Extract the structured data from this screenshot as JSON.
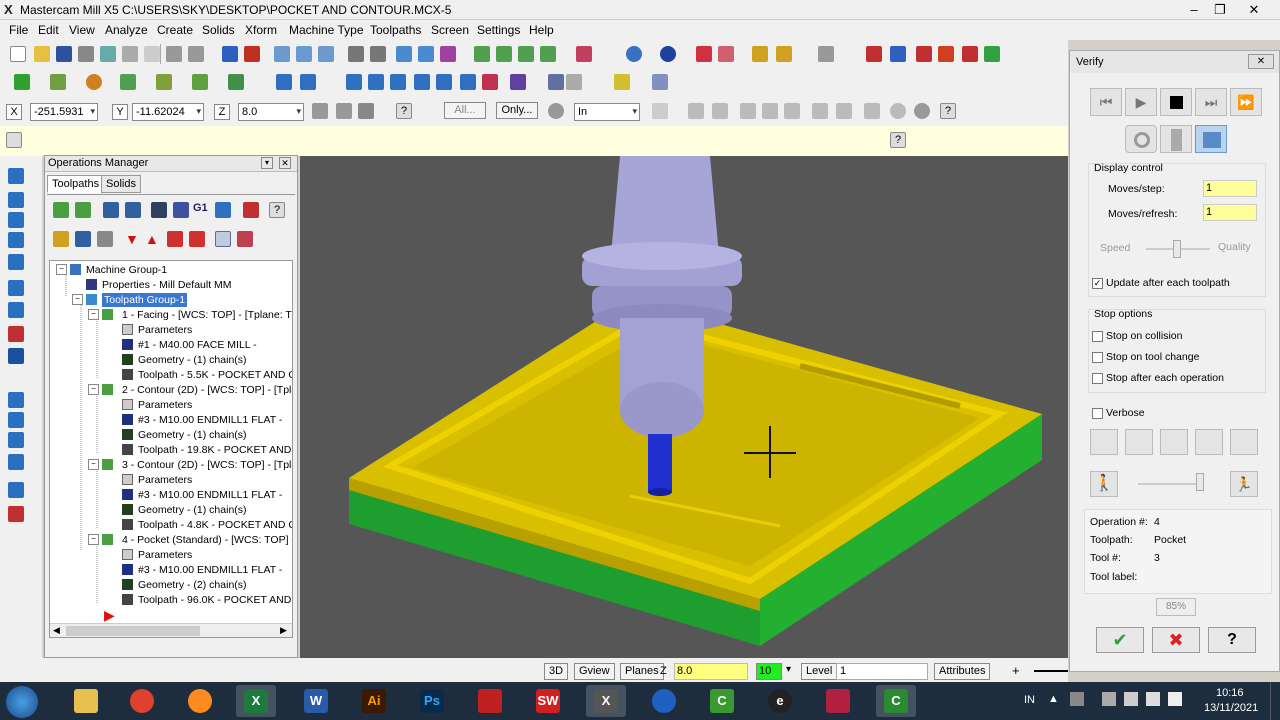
{
  "window": {
    "title": "Mastercam Mill X5  C:\\USERS\\SKY\\DESKTOP\\POCKET AND CONTOUR.MCX-5",
    "min": "–",
    "max": "❐",
    "close": "✕"
  },
  "menu": [
    "File",
    "Edit",
    "View",
    "Analyze",
    "Create",
    "Solids",
    "Xform",
    "Machine Type",
    "Toolpaths",
    "Screen",
    "Settings",
    "Help"
  ],
  "coords": {
    "x_label": "X",
    "x": "-251.5931",
    "y_label": "Y",
    "y": "-11.62024",
    "z_label": "Z",
    "z": "8.0",
    "all": "All...",
    "only": "Only...",
    "in": "In"
  },
  "opmgr": {
    "title": "Operations Manager",
    "tabs": [
      "Toolpaths",
      "Solids"
    ],
    "tree": [
      {
        "label": "Machine Group-1"
      },
      {
        "label": "Properties - Mill Default MM"
      },
      {
        "label": "Toolpath Group-1"
      },
      {
        "label": "1 - Facing - [WCS: TOP] - [Tplane: TO"
      },
      {
        "label": "Parameters"
      },
      {
        "label": "#1 - M40.00 FACE MILL -"
      },
      {
        "label": "Geometry - (1) chain(s)"
      },
      {
        "label": "Toolpath - 5.5K - POCKET AND CO"
      },
      {
        "label": "2 - Contour (2D) - [WCS: TOP] - [Tpla"
      },
      {
        "label": "Parameters"
      },
      {
        "label": "#3 - M10.00 ENDMILL1 FLAT -"
      },
      {
        "label": "Geometry - (1) chain(s)"
      },
      {
        "label": "Toolpath - 19.8K - POCKET AND C"
      },
      {
        "label": "3 - Contour (2D) - [WCS: TOP] - [Tpla"
      },
      {
        "label": "Parameters"
      },
      {
        "label": "#3 - M10.00 ENDMILL1 FLAT -"
      },
      {
        "label": "Geometry - (1) chain(s)"
      },
      {
        "label": "Toolpath - 4.8K - POCKET AND CO"
      },
      {
        "label": "4 - Pocket (Standard) - [WCS: TOP] -"
      },
      {
        "label": "Parameters"
      },
      {
        "label": "#3 - M10.00 ENDMILL1 FLAT -"
      },
      {
        "label": "Geometry - (2) chain(s)"
      },
      {
        "label": "Toolpath - 96.0K - POCKET AND C"
      }
    ]
  },
  "verify": {
    "title": "Verify",
    "close": "✕",
    "display_control": "Display control",
    "moves_step_label": "Moves/step:",
    "moves_step": "1",
    "moves_refresh_label": "Moves/refresh:",
    "moves_refresh": "1",
    "speed": "Speed",
    "quality": "Quality",
    "update_after": "Update after each toolpath",
    "stop_options": "Stop options",
    "stop_collision": "Stop on collision",
    "stop_tool_change": "Stop on tool change",
    "stop_each_op": "Stop after each operation",
    "verbose": "Verbose",
    "operation_label": "Operation #:",
    "operation": "4",
    "toolpath_label": "Toolpath:",
    "toolpath": "Pocket",
    "tool_label": "Tool #:",
    "tool": "3",
    "toollabel_label": "Tool label:",
    "percent": "85%",
    "ok": "✔",
    "cancel": "✖",
    "help": "?"
  },
  "status": {
    "view3d": "3D",
    "gview": "Gview",
    "planes": "Planes",
    "z_label": "Z",
    "z": "8.0",
    "color": "10",
    "level_label": "Level",
    "level": "1",
    "attributes": "Attributes"
  },
  "taskbar": {
    "lang": "IN",
    "time": "10:16",
    "date": "13/11/2021"
  }
}
